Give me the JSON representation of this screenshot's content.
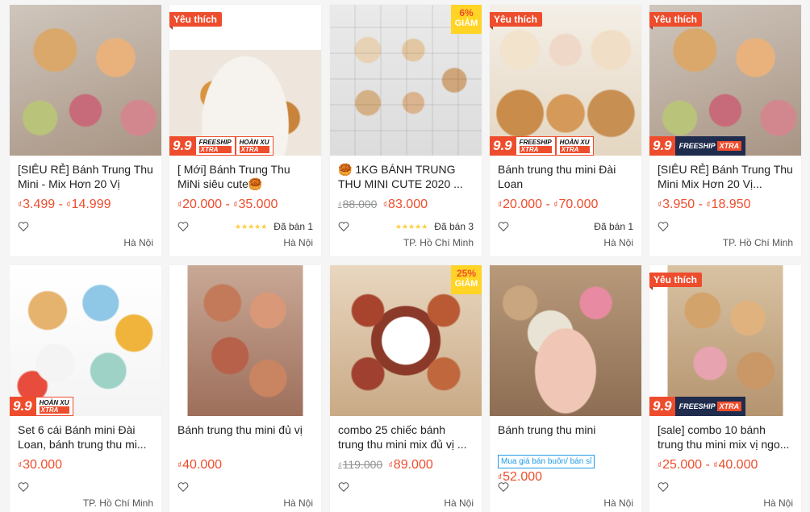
{
  "colors": {
    "brand": "#ee4d2d",
    "star": "#ffce3d",
    "wholesale": "#1e9be8"
  },
  "currency": "₫",
  "products": [
    {
      "title": "[SIÊU RẺ] Bánh Trung Thu Mini - Mix Hơn 20 Vị",
      "price_min": "3.499",
      "price_max": "14.999",
      "location": "Hà Nội",
      "fav": "",
      "promo": "",
      "discount_pct": "",
      "discount_label": "",
      "stars": "",
      "sold": "",
      "old_price": "",
      "wholesale": ""
    },
    {
      "title": "[ Mới] Bánh Trung Thu MiNi siêu cute🥮",
      "price_min": "20.000",
      "price_max": "35.000",
      "location": "Hà Nội",
      "fav": "Yêu thích",
      "promo": "9.9 FREESHIP XTRA HOÀN XU XTRA",
      "discount_pct": "",
      "discount_label": "",
      "stars": "★★★★★",
      "sold": "Đã bán 1",
      "old_price": "",
      "wholesale": ""
    },
    {
      "title": "🥮 1KG BÁNH TRUNG THU MINI CUTE 2020 ...",
      "price_min": "83.000",
      "price_max": "",
      "location": "TP. Hồ Chí Minh",
      "fav": "",
      "promo": "",
      "discount_pct": "6%",
      "discount_label": "GIẢM",
      "stars": "★★★★★",
      "sold": "Đã bán 3",
      "old_price": "88.000",
      "wholesale": ""
    },
    {
      "title": "Bánh trung thu mini Đài Loan",
      "price_min": "20.000",
      "price_max": "70.000",
      "location": "Hà Nội",
      "fav": "Yêu thích",
      "promo": "9.9 FREESHIP XTRA HOÀN XU XTRA",
      "discount_pct": "",
      "discount_label": "",
      "stars": "",
      "sold": "Đã bán 1",
      "old_price": "",
      "wholesale": ""
    },
    {
      "title": "[SIÊU RẺ] Bánh Trung Thu Mini Mix Hơn 20 Vị...",
      "price_min": "3.950",
      "price_max": "18.950",
      "location": "TP. Hồ Chí Minh",
      "fav": "Yêu thích",
      "promo": "9.9 FREESHIP XTRA",
      "discount_pct": "",
      "discount_label": "",
      "stars": "",
      "sold": "",
      "old_price": "",
      "wholesale": ""
    },
    {
      "title": "Set 6 cái Bánh mini Đài Loan, bánh trung thu mi...",
      "price_min": "30.000",
      "price_max": "",
      "location": "TP. Hồ Chí Minh",
      "fav": "",
      "promo": "9.9 HOÀN XU XTRA",
      "discount_pct": "",
      "discount_label": "",
      "stars": "",
      "sold": "",
      "old_price": "",
      "wholesale": ""
    },
    {
      "title": "Bánh trung thu mini đủ vị",
      "price_min": "40.000",
      "price_max": "",
      "location": "Hà Nội",
      "fav": "",
      "promo": "",
      "discount_pct": "",
      "discount_label": "",
      "stars": "",
      "sold": "",
      "old_price": "",
      "wholesale": ""
    },
    {
      "title": "combo 25 chiếc bánh trung thu mini mix đủ vị ...",
      "price_min": "89.000",
      "price_max": "",
      "location": "Hà Nội",
      "fav": "",
      "promo": "",
      "discount_pct": "25%",
      "discount_label": "GIẢM",
      "stars": "",
      "sold": "",
      "old_price": "119.000",
      "wholesale": ""
    },
    {
      "title": "Bánh trung thu mini",
      "price_min": "52.000",
      "price_max": "",
      "location": "Hà Nội",
      "fav": "",
      "promo": "",
      "discount_pct": "",
      "discount_label": "",
      "stars": "",
      "sold": "",
      "old_price": "",
      "wholesale": "Mua giá bán buôn/ bán sỉ"
    },
    {
      "title": "[sale] combo 10 bánh trung thu mini mix vị ngo...",
      "price_min": "25.000",
      "price_max": "40.000",
      "location": "Hà Nội",
      "fav": "Yêu thích",
      "promo": "9.9 FREESHIP XTRA",
      "discount_pct": "",
      "discount_label": "",
      "stars": "",
      "sold": "",
      "old_price": "",
      "wholesale": ""
    }
  ]
}
